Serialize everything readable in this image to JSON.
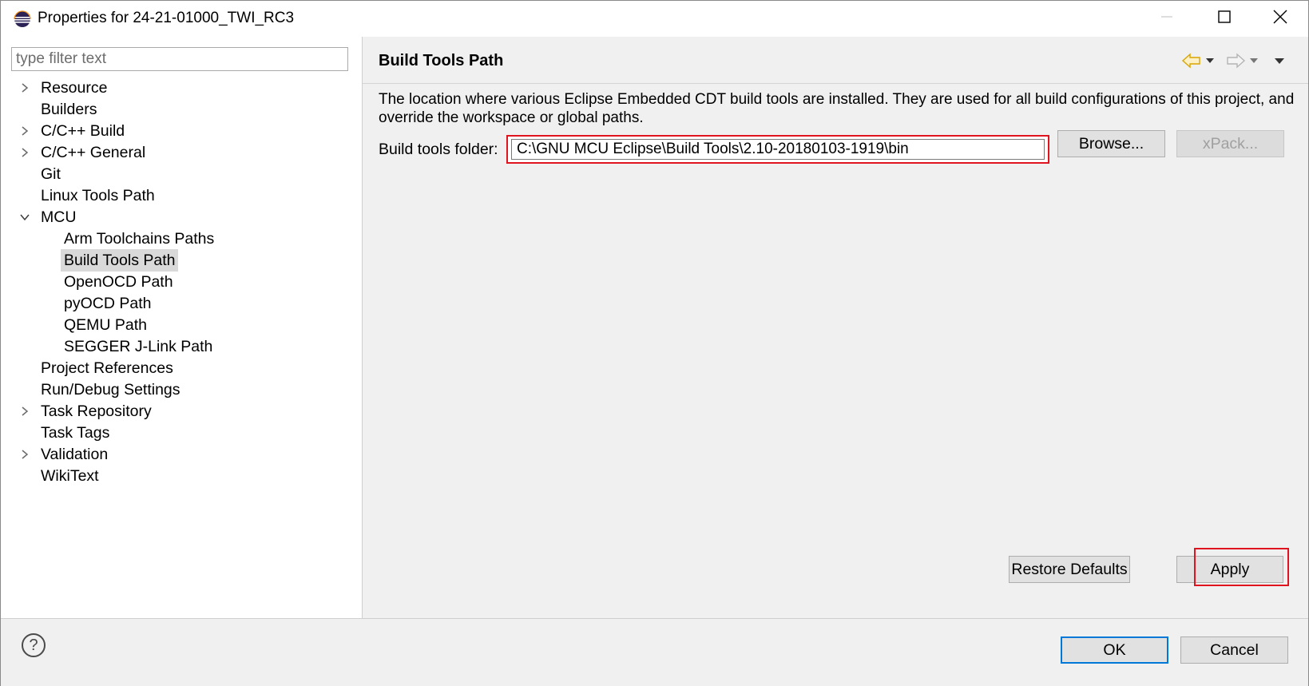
{
  "window": {
    "title": "Properties for 24-21-01000_TWI_RC3",
    "app_icon": "eclipse-icon",
    "controls": [
      "minimize-icon",
      "maximize-icon",
      "close-icon"
    ]
  },
  "sidebar": {
    "filter_placeholder": "type filter text",
    "items": [
      {
        "label": "Resource",
        "twisty": "collapsed"
      },
      {
        "label": "Builders",
        "twisty": "none"
      },
      {
        "label": "C/C++ Build",
        "twisty": "collapsed"
      },
      {
        "label": "C/C++ General",
        "twisty": "collapsed"
      },
      {
        "label": "Git",
        "twisty": "none"
      },
      {
        "label": "Linux Tools Path",
        "twisty": "none"
      },
      {
        "label": "MCU",
        "twisty": "expanded"
      },
      {
        "label": "Arm Toolchains Paths",
        "twisty": "none",
        "child": true
      },
      {
        "label": "Build Tools Path",
        "twisty": "none",
        "child": true,
        "selected": true
      },
      {
        "label": "OpenOCD Path",
        "twisty": "none",
        "child": true
      },
      {
        "label": "pyOCD Path",
        "twisty": "none",
        "child": true
      },
      {
        "label": "QEMU Path",
        "twisty": "none",
        "child": true
      },
      {
        "label": "SEGGER J-Link Path",
        "twisty": "none",
        "child": true
      },
      {
        "label": "Project References",
        "twisty": "none"
      },
      {
        "label": "Run/Debug Settings",
        "twisty": "none"
      },
      {
        "label": "Task Repository",
        "twisty": "collapsed"
      },
      {
        "label": "Task Tags",
        "twisty": "none"
      },
      {
        "label": "Validation",
        "twisty": "collapsed"
      },
      {
        "label": "WikiText",
        "twisty": "none"
      }
    ]
  },
  "page": {
    "title": "Build Tools Path",
    "nav_icons": [
      "back-arrow-icon",
      "back-dropdown-icon",
      "forward-arrow-icon",
      "forward-dropdown-icon",
      "view-menu-icon"
    ],
    "description": "The location where various Eclipse Embedded CDT build tools are installed. They are used for all build configurations of this project, and override the workspace or global paths.",
    "folder_label": "Build tools folder:",
    "folder_value": "C:\\GNU MCU Eclipse\\Build Tools\\2.10-20180103-1919\\bin",
    "browse_label": "Browse...",
    "xpack_label": "xPack...",
    "restore_label": "Restore Defaults",
    "apply_label": "Apply"
  },
  "footer": {
    "help_icon": "help-icon",
    "ok_label": "OK",
    "cancel_label": "Cancel"
  },
  "colors": {
    "highlight_red": "#e0141e",
    "primary_blue": "#0078d7",
    "panel_bg": "#f0f0f0"
  }
}
